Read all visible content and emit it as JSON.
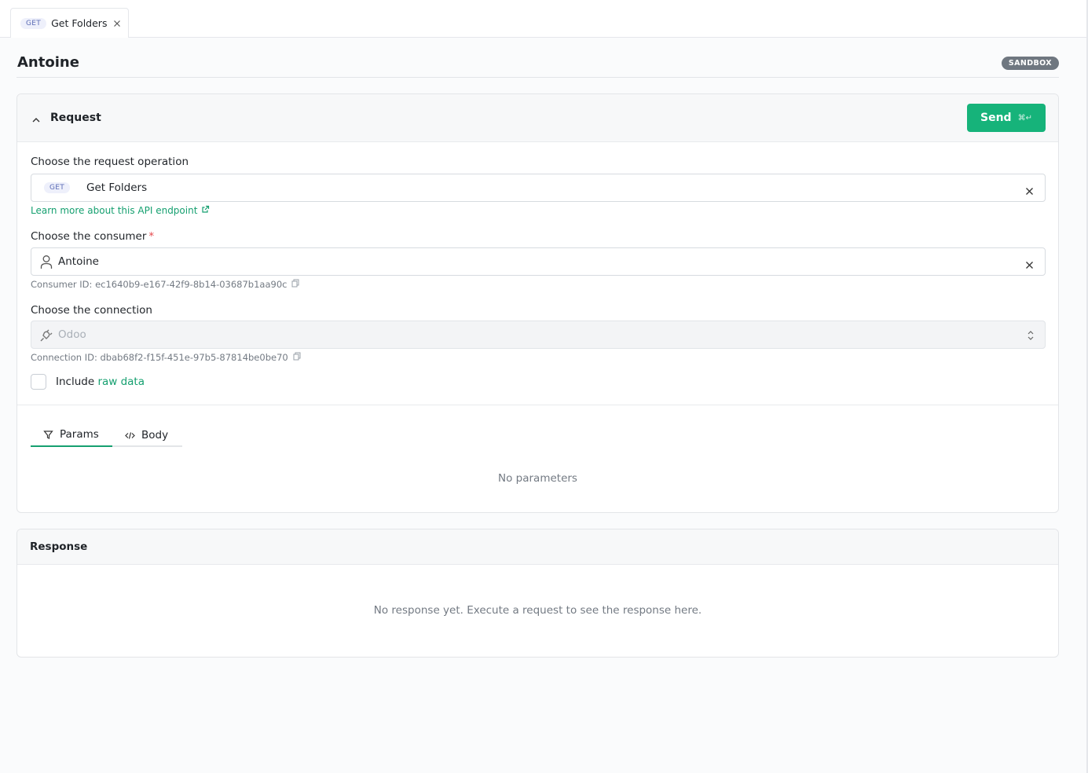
{
  "tab": {
    "method": "GET",
    "title": "Get Folders"
  },
  "header": {
    "name": "Antoine",
    "env_badge": "SANDBOX"
  },
  "request": {
    "section_title": "Request",
    "send_label": "Send",
    "send_shortcut": "⌘↵",
    "operation": {
      "label": "Choose the request operation",
      "method": "GET",
      "value": "Get Folders",
      "learn_more": "Learn more about this API endpoint"
    },
    "consumer": {
      "label": "Choose the consumer",
      "required_mark": "*",
      "value": "Antoine",
      "id_text": "Consumer ID: ec1640b9-e167-42f9-8b14-03687b1aa90c"
    },
    "connection": {
      "label": "Choose the connection",
      "value": "Odoo",
      "id_text": "Connection ID: dbab68f2-f15f-451e-97b5-87814be0be70"
    },
    "include_raw": {
      "prefix": "Include ",
      "link": "raw data",
      "checked": false
    },
    "tabs": [
      {
        "label": "Params",
        "icon": "filter-icon",
        "active": true
      },
      {
        "label": "Body",
        "icon": "code-icon",
        "active": false
      }
    ],
    "params_empty": "No parameters"
  },
  "response": {
    "section_title": "Response",
    "empty": "No response yet. Execute a request to see the response here."
  },
  "colors": {
    "accent": "#16b37a",
    "link": "#16a070",
    "badge": "#6f7780",
    "required": "#e5484d"
  }
}
